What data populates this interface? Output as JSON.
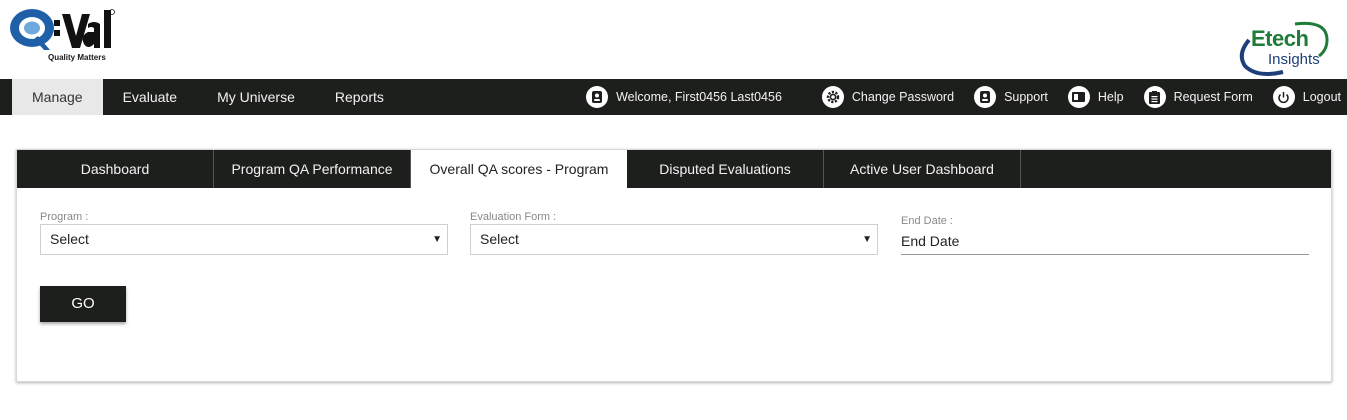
{
  "brand": {
    "logo_text": "Q-eval",
    "tagline": "Quality Matters",
    "partner_logo_line1": "Etech",
    "partner_logo_line2": "Insights"
  },
  "topnav": {
    "items": [
      {
        "label": "Manage",
        "active": true
      },
      {
        "label": "Evaluate",
        "active": false
      },
      {
        "label": "My Universe",
        "active": false
      },
      {
        "label": "Reports",
        "active": false
      }
    ],
    "welcome": "Welcome, First0456 Last0456",
    "links": [
      {
        "label": "Change Password",
        "icon": "gear-icon"
      },
      {
        "label": "Support",
        "icon": "support-icon"
      },
      {
        "label": "Help",
        "icon": "book-icon"
      },
      {
        "label": "Request Form",
        "icon": "clipboard-icon"
      },
      {
        "label": "Logout",
        "icon": "power-icon"
      }
    ]
  },
  "tabs": [
    {
      "label": "Dashboard",
      "active": false
    },
    {
      "label": "Program QA Performance",
      "active": false
    },
    {
      "label": "Overall QA scores - Program",
      "active": true
    },
    {
      "label": "Disputed Evaluations",
      "active": false
    },
    {
      "label": "Active User Dashboard",
      "active": false
    }
  ],
  "form": {
    "program": {
      "label": "Program :",
      "value": "Select"
    },
    "evaluation_form": {
      "label": "Evaluation Form :",
      "value": "Select"
    },
    "end_date": {
      "label": "End Date :",
      "placeholder": "End Date"
    },
    "go_label": "GO"
  },
  "colors": {
    "nav_bg": "#1d1f1c",
    "active_nav_bg": "#e8e8e8",
    "brand_blue": "#1f5fa8",
    "brand_green": "#1e7b3a"
  }
}
